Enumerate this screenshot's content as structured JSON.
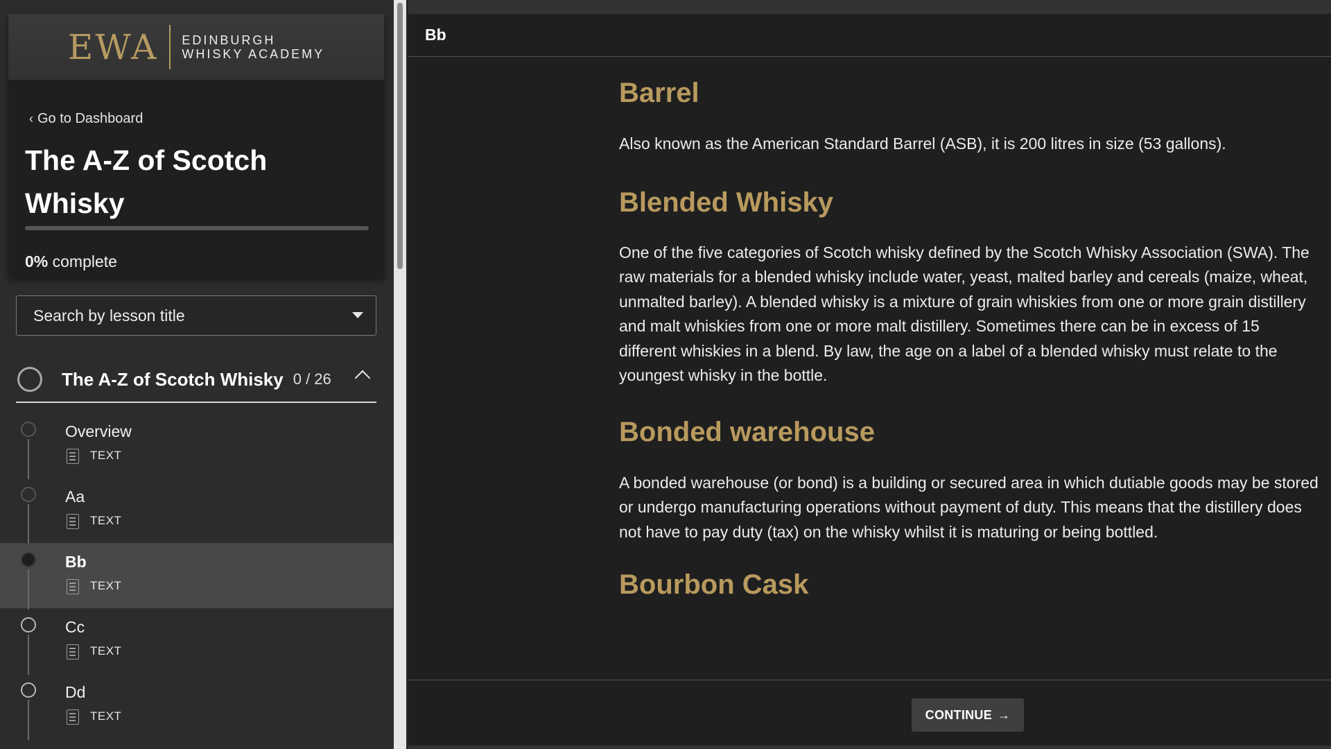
{
  "brand": {
    "mark": "EWA",
    "line1": "EDINBURGH",
    "line2": "WHISKY ACADEMY",
    "accent_color": "#b59a62"
  },
  "sidebar": {
    "back_link": "Go to Dashboard",
    "course_title": "The A-Z of Scotch Whisky",
    "progress": {
      "value": 0,
      "percent_label": "0%",
      "suffix": " complete"
    },
    "search": {
      "placeholder": "Search by lesson title"
    },
    "section": {
      "title": "The A-Z of Scotch Whisky",
      "count": "0 / 26",
      "expanded": true
    },
    "lessons": [
      {
        "name": "Overview",
        "type": "TEXT",
        "state": "incomplete"
      },
      {
        "name": "Aa",
        "type": "TEXT",
        "state": "incomplete"
      },
      {
        "name": "Bb",
        "type": "TEXT",
        "state": "active"
      },
      {
        "name": "Cc",
        "type": "TEXT",
        "state": "incomplete"
      },
      {
        "name": "Dd",
        "type": "TEXT",
        "state": "incomplete"
      }
    ]
  },
  "main": {
    "header_title": "Bb",
    "entries": [
      {
        "term": "Barrel",
        "text": "Also known as the American Standard Barrel (ASB), it is 200 litres in size (53 gallons)."
      },
      {
        "term": "Blended Whisky",
        "text": "One of the five categories of Scotch whisky defined by the Scotch Whisky Association (SWA). The raw materials for a blended whisky include water, yeast, malted barley and cereals (maize, wheat, unmalted barley). A blended whisky is a mixture of grain whiskies from one or more grain distillery and malt whiskies from one or more malt distillery. Sometimes there can be in excess of 15 different whiskies in a blend. By law, the age on a label of a blended whisky must relate to the youngest whisky in the bottle."
      },
      {
        "term": "Bonded warehouse",
        "text": "A bonded warehouse (or bond) is a building or secured area in which dutiable goods may be stored or undergo manufacturing operations without payment of duty. This means that the distillery does not have to pay duty (tax) on the whisky whilst it is maturing or being bottled."
      },
      {
        "term": "Bourbon Cask",
        "text": ""
      }
    ],
    "continue_label": "CONTINUE",
    "term_color": "#b89a5e"
  }
}
